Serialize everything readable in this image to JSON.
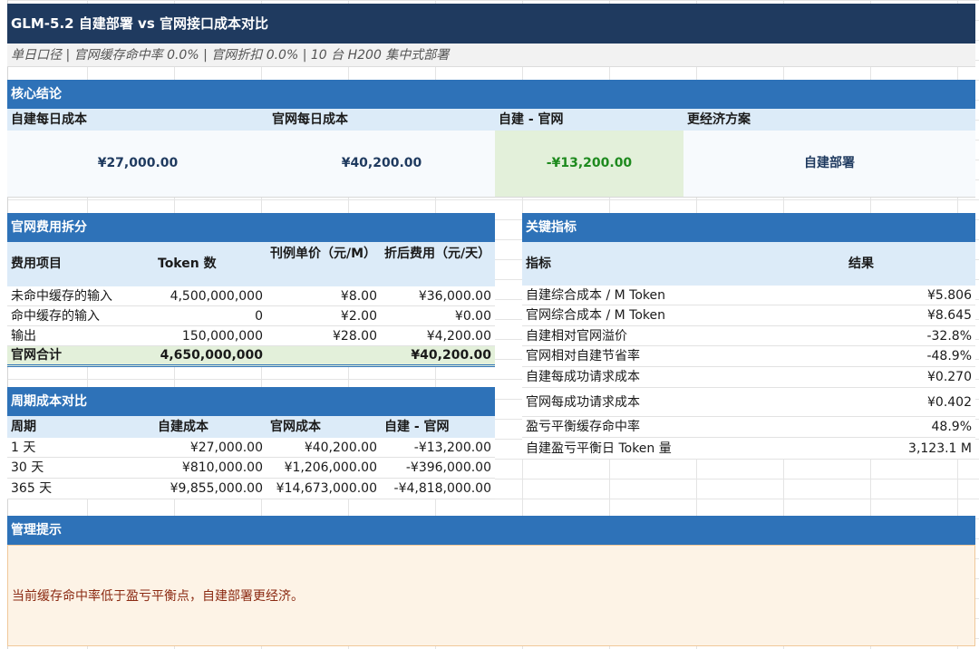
{
  "title": "GLM-5.2 自建部署 vs 官网接口成本对比",
  "subtitle": "单日口径 | 官网缓存命中率 0.0% | 官网折扣 0.0% | 10 台 H200 集中式部署",
  "summary": {
    "section_title": "核心结论",
    "headers": [
      "自建每日成本",
      "官网每日成本",
      "自建 - 官网",
      "更经济方案"
    ],
    "values": [
      "¥27,000.00",
      "¥40,200.00",
      "-¥13,200.00",
      "自建部署"
    ]
  },
  "fee_breakdown": {
    "section_title": "官网费用拆分",
    "headers": [
      "费用项目",
      "Token 数",
      "刊例单价（元/M）",
      "折后费用（元/天）"
    ],
    "rows": [
      [
        "未命中缓存的输入",
        "4,500,000,000",
        "¥8.00",
        "¥36,000.00"
      ],
      [
        "命中缓存的输入",
        "0",
        "¥2.00",
        "¥0.00"
      ],
      [
        "输出",
        "150,000,000",
        "¥28.00",
        "¥4,200.00"
      ]
    ],
    "total": [
      "官网合计",
      "4,650,000,000",
      "",
      "¥40,200.00"
    ]
  },
  "period": {
    "section_title": "周期成本对比",
    "headers": [
      "周期",
      "自建成本",
      "官网成本",
      "自建 - 官网"
    ],
    "rows": [
      [
        "1 天",
        "¥27,000.00",
        "¥40,200.00",
        "-¥13,200.00"
      ],
      [
        "30 天",
        "¥810,000.00",
        "¥1,206,000.00",
        "-¥396,000.00"
      ],
      [
        "365 天",
        "¥9,855,000.00",
        "¥14,673,000.00",
        "-¥4,818,000.00"
      ]
    ]
  },
  "metrics": {
    "section_title": "关键指标",
    "headers": [
      "指标",
      "结果"
    ],
    "rows": [
      [
        "自建综合成本 / M Token",
        "¥5.806"
      ],
      [
        "官网综合成本 / M Token",
        "¥8.645"
      ],
      [
        "自建相对官网溢价",
        "-32.8%"
      ],
      [
        "官网相对自建节省率",
        "-48.9%"
      ],
      [
        "自建每成功请求成本",
        "¥0.270"
      ],
      [
        "官网每成功请求成本",
        "¥0.402"
      ],
      [
        "盈亏平衡缓存命中率",
        "48.9%"
      ],
      [
        "自建盈亏平衡日 Token 量",
        "3,123.1 M"
      ]
    ]
  },
  "tips": {
    "section_title": "管理提示",
    "text": "当前缓存命中率低于盈亏平衡点，自建部署更经济。"
  },
  "colors": {
    "title_bg": "#1f3a5f",
    "section_bg": "#2e72b8",
    "header_bg": "#dcebf8",
    "highlight_green": "#e3f0da",
    "negative_green": "#1e8a1e",
    "tips_bg": "#fdf3e6"
  }
}
